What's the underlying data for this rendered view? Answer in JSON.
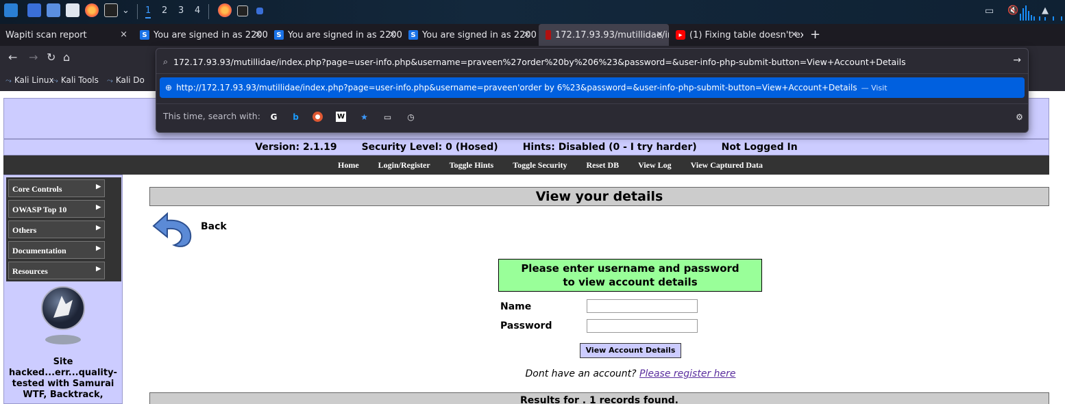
{
  "panel": {
    "workspaces": [
      "1",
      "2",
      "3",
      "4"
    ],
    "active_workspace": "1"
  },
  "tabs": [
    {
      "title": "Wapiti scan report",
      "close": "×"
    },
    {
      "title": "You are signed in as 2200",
      "close": "×"
    },
    {
      "title": "You are signed in as 2200",
      "close": "×"
    },
    {
      "title": "You are signed in as 2200",
      "close": "×"
    },
    {
      "title": "172.17.93.93/mutillidae/in",
      "close": "×"
    },
    {
      "title": "(1) Fixing table doesn't exi",
      "close": "×"
    }
  ],
  "new_tab": "+",
  "url_bar": {
    "value": "172.17.93.93/mutillidae/index.php?page=user-info.php&username=praveen%27order%20by%206%23&password=&user-info-php-submit-button=View+Account+Details",
    "suggestion": "http://172.17.93.93/mutillidae/index.php?page=user-info.php&username=praveen'order by 6%23&password=&user-info-php-submit-button=View+Account+Details",
    "suggestion_action": "— Visit",
    "search_with_label": "This time, search with:"
  },
  "bookmarks": [
    "Kali Linux",
    "Kali Tools",
    "Kali Do"
  ],
  "site": {
    "version": "Version: 2.1.19",
    "security": "Security Level: 0 (Hosed)",
    "hints": "Hints: Disabled (0 - I try harder)",
    "login_status": "Not Logged In",
    "menu": [
      "Home",
      "Login/Register",
      "Toggle Hints",
      "Toggle Security",
      "Reset DB",
      "View Log",
      "View Captured Data"
    ],
    "side_menu": [
      "Core Controls",
      "OWASP Top 10",
      "Others",
      "Documentation",
      "Resources"
    ],
    "hacked_text": "Site hacked...err...quality-tested with Samurai WTF, Backtrack,",
    "page_title": "View your details",
    "back_label": "Back",
    "instructions_line1": "Please enter username and password",
    "instructions_line2": "to view account details",
    "name_label": "Name",
    "password_label": "Password",
    "submit_label": "View Account Details",
    "no_account_text": "Dont have an account?",
    "register_link": "Please register here",
    "results_text": "Results for . 1 records found."
  },
  "colors": {
    "header_bg": "#ccccff",
    "menu_bg": "#333333",
    "instruction_bg": "#99ff99",
    "suggest_bg": "#0060df",
    "tab_bg": "#1c1b22"
  }
}
